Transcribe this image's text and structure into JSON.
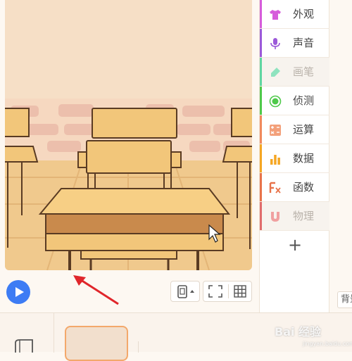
{
  "categories": [
    {
      "label": "外观",
      "icon": "shirt-icon",
      "color": "#d65cdb",
      "enabled": true
    },
    {
      "label": "声音",
      "icon": "microphone-icon",
      "color": "#9b59d9",
      "enabled": true
    },
    {
      "label": "画笔",
      "icon": "pen-icon",
      "color": "#5fd6a2",
      "enabled": false
    },
    {
      "label": "侦测",
      "icon": "sensing-icon",
      "color": "#4ec94a",
      "enabled": true
    },
    {
      "label": "运算",
      "icon": "operator-icon",
      "color": "#f08a5d",
      "enabled": true
    },
    {
      "label": "数据",
      "icon": "bar-chart-icon",
      "color": "#f5a623",
      "enabled": true
    },
    {
      "label": "函数",
      "icon": "function-icon",
      "color": "#e8734a",
      "enabled": true
    },
    {
      "label": "物理",
      "icon": "magnet-icon",
      "color": "#e06c6c",
      "enabled": false
    }
  ],
  "add_category_label": "+",
  "backdrop_tab_label": "背景",
  "watermark": {
    "text": "Bai 经验",
    "sub": "jingyan.baidu.com"
  },
  "colors": {
    "accent": "#3d7cf4",
    "stage_bg": "#f6dfc6"
  }
}
